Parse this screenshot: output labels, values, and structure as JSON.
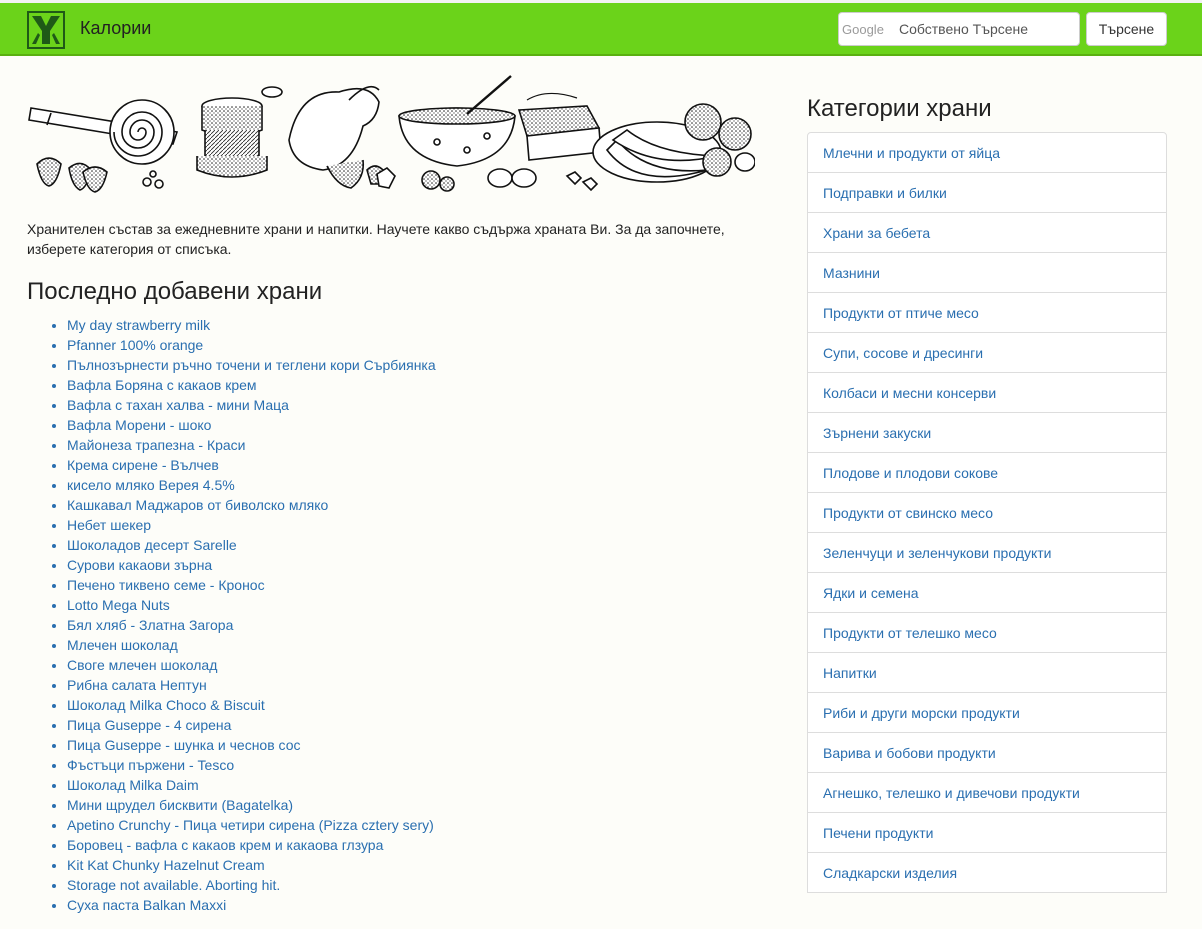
{
  "navbar": {
    "brand": "Калории",
    "search": {
      "google_label": "Google",
      "placeholder": "Собствено Търсене",
      "button_label": "Търсене"
    }
  },
  "main": {
    "intro": "Хранителен състав за ежедневните храни и напитки. Научете какво съдържа храната Ви. За да започнете, изберете категория от списъка.",
    "recent_title": "Последно добавени храни",
    "recent_foods": [
      "My day strawberry milk",
      "Pfanner 100% orange",
      "Пълнозърнести ръчно точени и теглени кори Сърбиянка",
      "Вафла Боряна с какаов крем",
      "Вафла с тахан халва - мини Маца",
      "Вафла Морени - шоко",
      "Майонеза трапезна - Краси",
      "Крема сирене - Вълчев",
      "кисело мляко Верея 4.5%",
      "Кашкавал Маджаров от биволско мляко",
      "Небет шекер",
      "Шоколадов десерт Sarelle",
      "Сурови какаови зърна",
      "Печено тиквено семе - Кронос",
      "Lotto Mega Nuts",
      "Бял хляб - Златна Загора",
      "Млечен шоколад",
      "Своге млечен шоколад",
      "Рибна салата Нептун",
      "Шоколад Milka Choco & Biscuit",
      "Пица Guseppe - 4 сирена",
      "Пица Guseppe - шунка и чеснов сос",
      "Фъстъци пържени - Tesco",
      "Шоколад Milka Daim",
      "Мини щрудел бисквити (Bagatelka)",
      "Apetino Crunchy - Пица четири сирена (Pizza cztery sery)",
      "Боровец - вафла с какаов крем и какаова глзура",
      "Kit Kat Chunky Hazelnut Cream",
      "Storage not available. Aborting hit.",
      "Суха паста Balkan Maxxi"
    ]
  },
  "sidebar": {
    "title": "Категории храни",
    "categories": [
      "Млечни и продукти от яйца",
      "Подправки и билки",
      "Храни за бебета",
      "Мазнини",
      "Продукти от птиче месо",
      "Супи, сосове и дресинги",
      "Колбаси и месни консерви",
      "Зърнени закуски",
      "Плодове и плодови сокове",
      "Продукти от свинско месо",
      "Зеленчуци и зеленчукови продукти",
      "Ядки и семена",
      "Продукти от телешко месо",
      "Напитки",
      "Риби и други морски продукти",
      "Варива и бобови продукти",
      "Агнешко, телешко и дивечови продукти",
      "Печени продукти",
      "Сладкарски изделия"
    ]
  },
  "colors": {
    "navbar": "#6bd31a",
    "link": "#2a6fb0",
    "background": "#fdfdf9"
  },
  "icons": {
    "logo": "site-logo-icon"
  }
}
